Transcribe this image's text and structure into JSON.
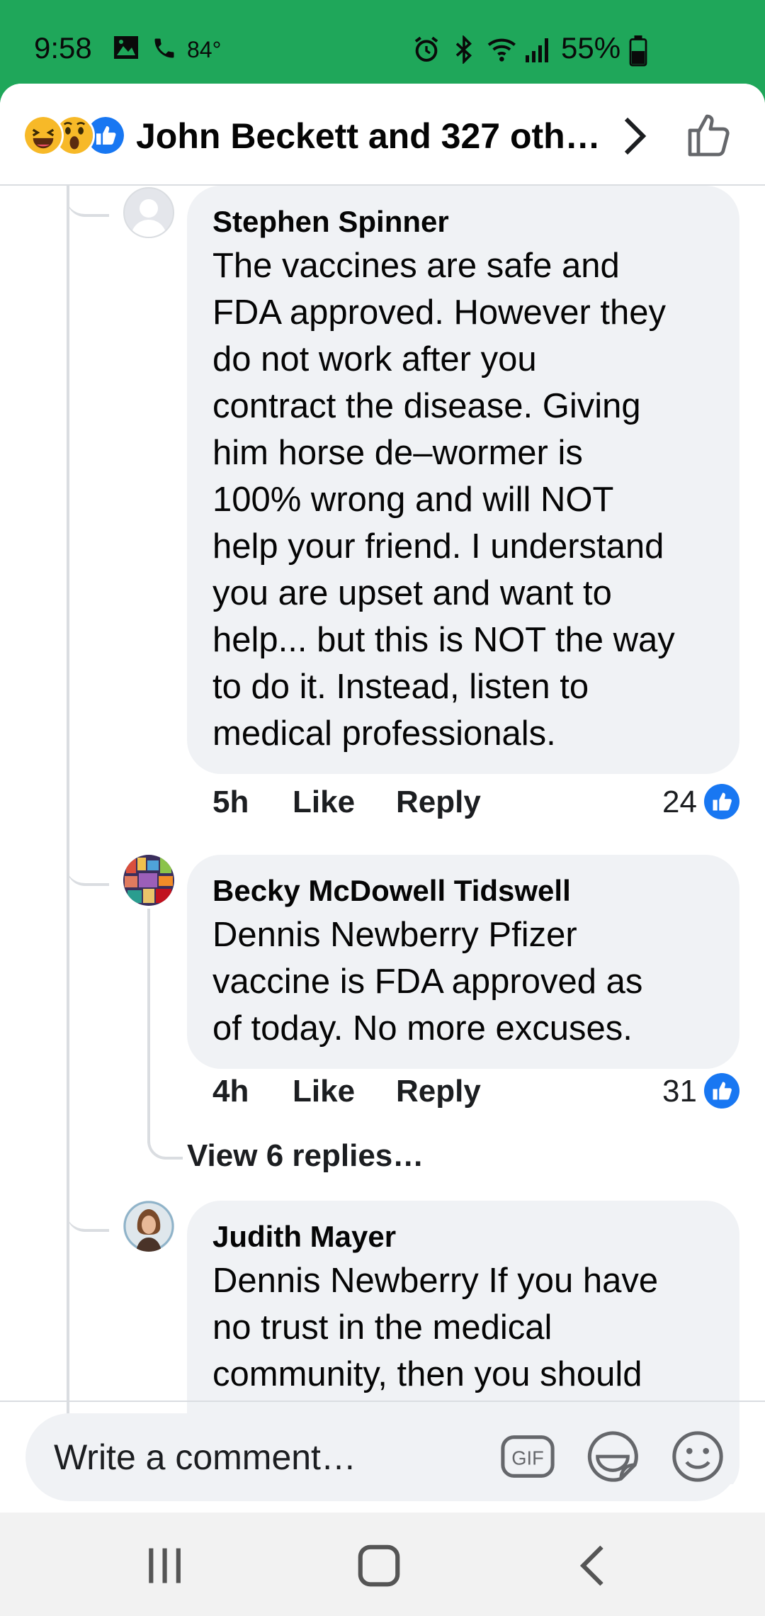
{
  "status_bar": {
    "time": "9:58",
    "temperature": "84°",
    "battery": "55%",
    "icons": [
      "image-icon",
      "phone-icon",
      "alarm-icon",
      "bluetooth-icon",
      "wifi-icon",
      "signal-icon",
      "battery-icon"
    ]
  },
  "header": {
    "reactions": [
      "haha-icon",
      "wow-icon",
      "like-icon"
    ],
    "title": "John Beckett and 327 oth…",
    "icons": [
      "chevron-right-icon",
      "thumbs-up-outline-icon"
    ]
  },
  "comments": [
    {
      "author": "Stephen Spinner",
      "text": "The vaccines are safe and\nFDA approved. However they\ndo not work after you\ncontract the disease.  Giving\nhim horse de–wormer is\n100% wrong and will NOT\nhelp your friend.  I understand\nyou are upset and want to\nhelp... but this is NOT the way\nto do it.  Instead, listen to\nmedical professionals.",
      "time": "5h",
      "like_label": "Like",
      "reply_label": "Reply",
      "reaction_count": "24",
      "avatar": "default-avatar"
    },
    {
      "author": "Becky McDowell Tidswell",
      "text": "Dennis Newberry Pfizer\nvaccine is FDA approved as\nof today. No more excuses.",
      "time": "4h",
      "like_label": "Like",
      "reply_label": "Reply",
      "reaction_count": "31",
      "avatar": "colorful-photo-avatar",
      "view_replies": "View 6 replies…"
    },
    {
      "author": "Judith Mayer",
      "text": "Dennis Newberry  If you have\nno trust in the medical\ncommunity, then you should",
      "avatar": "portrait-photo-avatar"
    }
  ],
  "composer": {
    "placeholder": "Write a comment…",
    "gif_label": "GIF",
    "icons": [
      "gif-icon",
      "sticker-icon",
      "emoji-icon"
    ]
  },
  "colors": {
    "status_bar": "#1fa75a",
    "bubble": "#f0f2f5",
    "like_blue": "#1877f2"
  }
}
